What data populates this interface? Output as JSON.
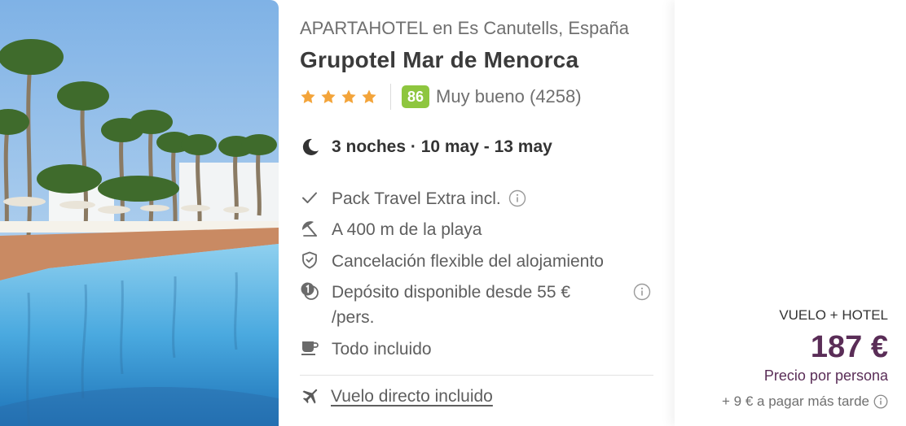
{
  "hotel": {
    "type_location": "APARTAHOTEL en Es Canutells, España",
    "name": "Grupotel Mar de Menorca",
    "stars": 4,
    "score": "86",
    "score_text": "Muy bueno (4258)"
  },
  "stay": {
    "summary": "3 noches · 10 may - 13 may"
  },
  "features": [
    {
      "icon": "check-icon",
      "text": "Pack Travel Extra incl.",
      "has_info": true
    },
    {
      "icon": "beach-umbrella-icon",
      "text": "A 400 m de la playa",
      "has_info": false
    },
    {
      "icon": "shield-check-icon",
      "text": "Cancelación flexible del alojamiento",
      "has_info": false
    },
    {
      "icon": "deposit-coins-icon",
      "text_line1": "Depósito disponible desde 55 €",
      "text_line2": "/pers.",
      "has_info": true
    },
    {
      "icon": "coffee-cup-icon",
      "text": "Todo incluido",
      "has_info": false
    }
  ],
  "flight": {
    "icon": "airplane-icon",
    "label": "Vuelo directo incluido"
  },
  "price": {
    "label": "VUELO + HOTEL",
    "amount": "187 €",
    "per_person": "Precio por persona",
    "pay_later": "+ 9 € a pagar más tarde"
  },
  "colors": {
    "star": "#f3a43a",
    "score_badge": "#8ec63f",
    "price": "#5a2d57",
    "muted_text": "#6f6f6f"
  }
}
